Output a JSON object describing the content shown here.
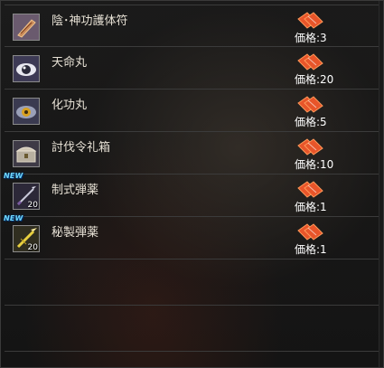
{
  "shop": {
    "price_prefix": "価格:",
    "items": [
      {
        "name": "陰･神功護体符",
        "price": "価格:3",
        "qty": "",
        "new": "",
        "icon": "talisman-icon"
      },
      {
        "name": "天命丸",
        "price": "価格:20",
        "qty": "",
        "new": "",
        "icon": "eye-pill-icon"
      },
      {
        "name": "化功丸",
        "price": "価格:5",
        "qty": "",
        "new": "",
        "icon": "golden-eye-pill-icon"
      },
      {
        "name": "討伐令礼箱",
        "price": "価格:10",
        "qty": "",
        "new": "",
        "icon": "chest-icon"
      },
      {
        "name": "制式弾薬",
        "price": "価格:1",
        "qty": "20",
        "new": "NEW",
        "icon": "dart-icon"
      },
      {
        "name": "秘製弾薬",
        "price": "価格:1",
        "qty": "20",
        "new": "NEW",
        "icon": "golden-dart-icon"
      }
    ],
    "currency_icon": "ticket-icon",
    "colors": {
      "item_name": "#e6e0d4",
      "price": "#ffffff",
      "new_badge": "#6fd8ff",
      "ticket": "#e8552a"
    }
  }
}
